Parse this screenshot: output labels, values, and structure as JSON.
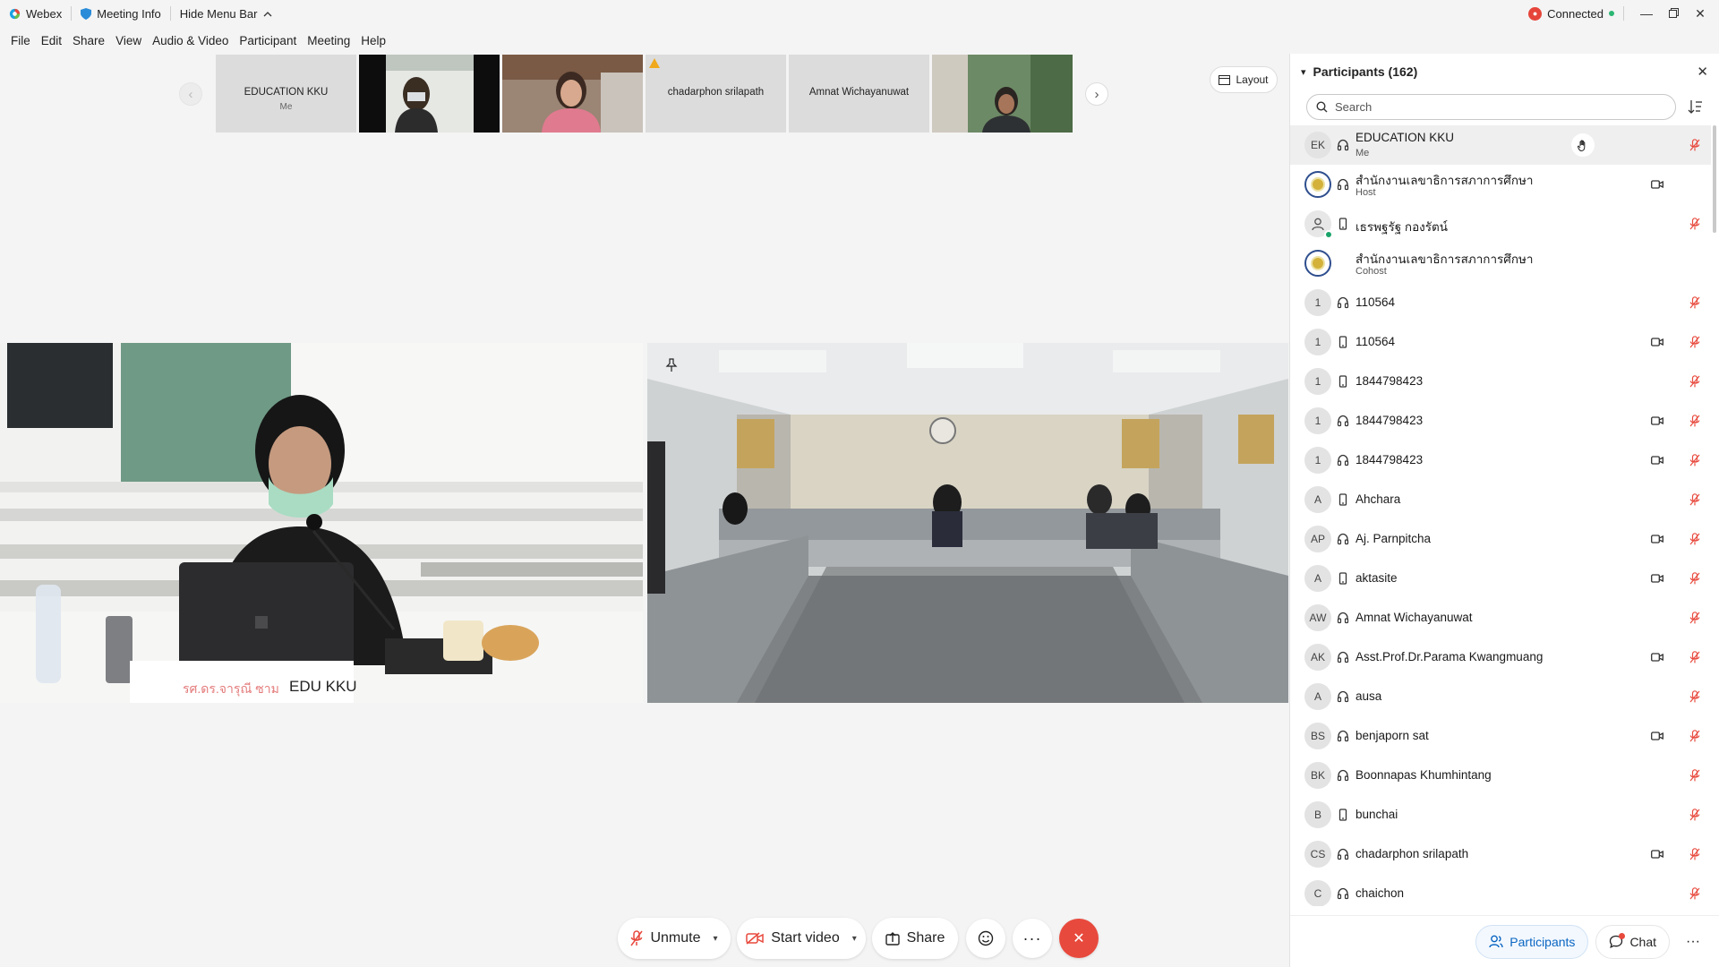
{
  "titlebar": {
    "app_name": "Webex",
    "meeting_info": "Meeting Info",
    "hide_menu": "Hide Menu Bar",
    "status": "Connected"
  },
  "menu": [
    "File",
    "Edit",
    "Share",
    "View",
    "Audio & Video",
    "Participant",
    "Meeting",
    "Help"
  ],
  "menu_underline": [
    "F",
    "E",
    "S",
    "V",
    "A",
    "P",
    "M",
    "H"
  ],
  "strip": {
    "thumbs": [
      {
        "name": "EDUCATION KKU",
        "sub": "Me",
        "type": "label"
      },
      {
        "name": "",
        "type": "video"
      },
      {
        "name": "",
        "type": "video"
      },
      {
        "name": "chadarphon srilapath",
        "type": "label",
        "warning": true
      },
      {
        "name": "Amnat Wichayanuwat",
        "type": "label"
      },
      {
        "name": "",
        "type": "video"
      }
    ],
    "layout_label": "Layout"
  },
  "videos": {
    "left_name": "EDU KKU",
    "left_placard": "รศ.ดร.จารุณี ซาม"
  },
  "controls": {
    "unmute": "Unmute",
    "start_video": "Start video",
    "share": "Share"
  },
  "panel": {
    "title": "Participants (162)",
    "search_placeholder": "Search",
    "participants": [
      {
        "initials": "EK",
        "name": "EDUCATION KKU",
        "role": "Me",
        "conn": "headset",
        "cam": false,
        "muted": true,
        "hand": true,
        "avatar": "initials"
      },
      {
        "initials": "",
        "name": "สำนักงานเลขาธิการสภาการศึกษา",
        "role": "Host",
        "conn": "headset",
        "cam": true,
        "muted": false,
        "avatar": "seal"
      },
      {
        "initials": "",
        "name": "เธรพฐรัฐ กองรัตน์",
        "role": "",
        "conn": "phone",
        "cam": false,
        "muted": true,
        "avatar": "user"
      },
      {
        "initials": "",
        "name": "สำนักงานเลขาธิการสภาการศึกษา",
        "role": "Cohost",
        "conn": "",
        "cam": false,
        "muted": false,
        "avatar": "seal"
      },
      {
        "initials": "1",
        "name": "110564",
        "role": "",
        "conn": "headset",
        "cam": false,
        "muted": true,
        "avatar": "initials"
      },
      {
        "initials": "1",
        "name": "110564",
        "role": "",
        "conn": "phone",
        "cam": true,
        "muted": true,
        "avatar": "initials"
      },
      {
        "initials": "1",
        "name": "1844798423",
        "role": "",
        "conn": "phone",
        "cam": false,
        "muted": true,
        "avatar": "initials"
      },
      {
        "initials": "1",
        "name": "1844798423",
        "role": "",
        "conn": "headset",
        "cam": true,
        "muted": true,
        "avatar": "initials"
      },
      {
        "initials": "1",
        "name": "1844798423",
        "role": "",
        "conn": "headset",
        "cam": true,
        "muted": true,
        "avatar": "initials"
      },
      {
        "initials": "A",
        "name": "Ahchara",
        "role": "",
        "conn": "phone",
        "cam": false,
        "muted": true,
        "avatar": "initials"
      },
      {
        "initials": "AP",
        "name": "Aj. Parnpitcha",
        "role": "",
        "conn": "headset",
        "cam": true,
        "muted": true,
        "avatar": "initials"
      },
      {
        "initials": "A",
        "name": "aktasite",
        "role": "",
        "conn": "phone",
        "cam": true,
        "muted": true,
        "avatar": "initials"
      },
      {
        "initials": "AW",
        "name": "Amnat Wichayanuwat",
        "role": "",
        "conn": "headset",
        "cam": false,
        "muted": true,
        "avatar": "initials"
      },
      {
        "initials": "AK",
        "name": "Asst.Prof.Dr.Parama Kwangmuang",
        "role": "",
        "conn": "headset",
        "cam": true,
        "muted": true,
        "avatar": "initials"
      },
      {
        "initials": "A",
        "name": "ausa",
        "role": "",
        "conn": "headset",
        "cam": false,
        "muted": true,
        "avatar": "initials"
      },
      {
        "initials": "BS",
        "name": "benjaporn sat",
        "role": "",
        "conn": "headset",
        "cam": true,
        "muted": true,
        "avatar": "initials"
      },
      {
        "initials": "BK",
        "name": "Boonnapas Khumhintang",
        "role": "",
        "conn": "headset",
        "cam": false,
        "muted": true,
        "avatar": "initials"
      },
      {
        "initials": "B",
        "name": "bunchai",
        "role": "",
        "conn": "phone",
        "cam": false,
        "muted": true,
        "avatar": "initials"
      },
      {
        "initials": "CS",
        "name": "chadarphon srilapath",
        "role": "",
        "conn": "headset",
        "cam": true,
        "muted": true,
        "avatar": "initials"
      },
      {
        "initials": "C",
        "name": "chaichon",
        "role": "",
        "conn": "headset",
        "cam": false,
        "muted": true,
        "avatar": "initials"
      }
    ],
    "footer": {
      "participants": "Participants",
      "chat": "Chat"
    }
  },
  "colors": {
    "end_call": "#e8493d",
    "mute_red": "#e8493d",
    "active_blue": "#0a66c2",
    "connected_green": "#2bb673"
  }
}
